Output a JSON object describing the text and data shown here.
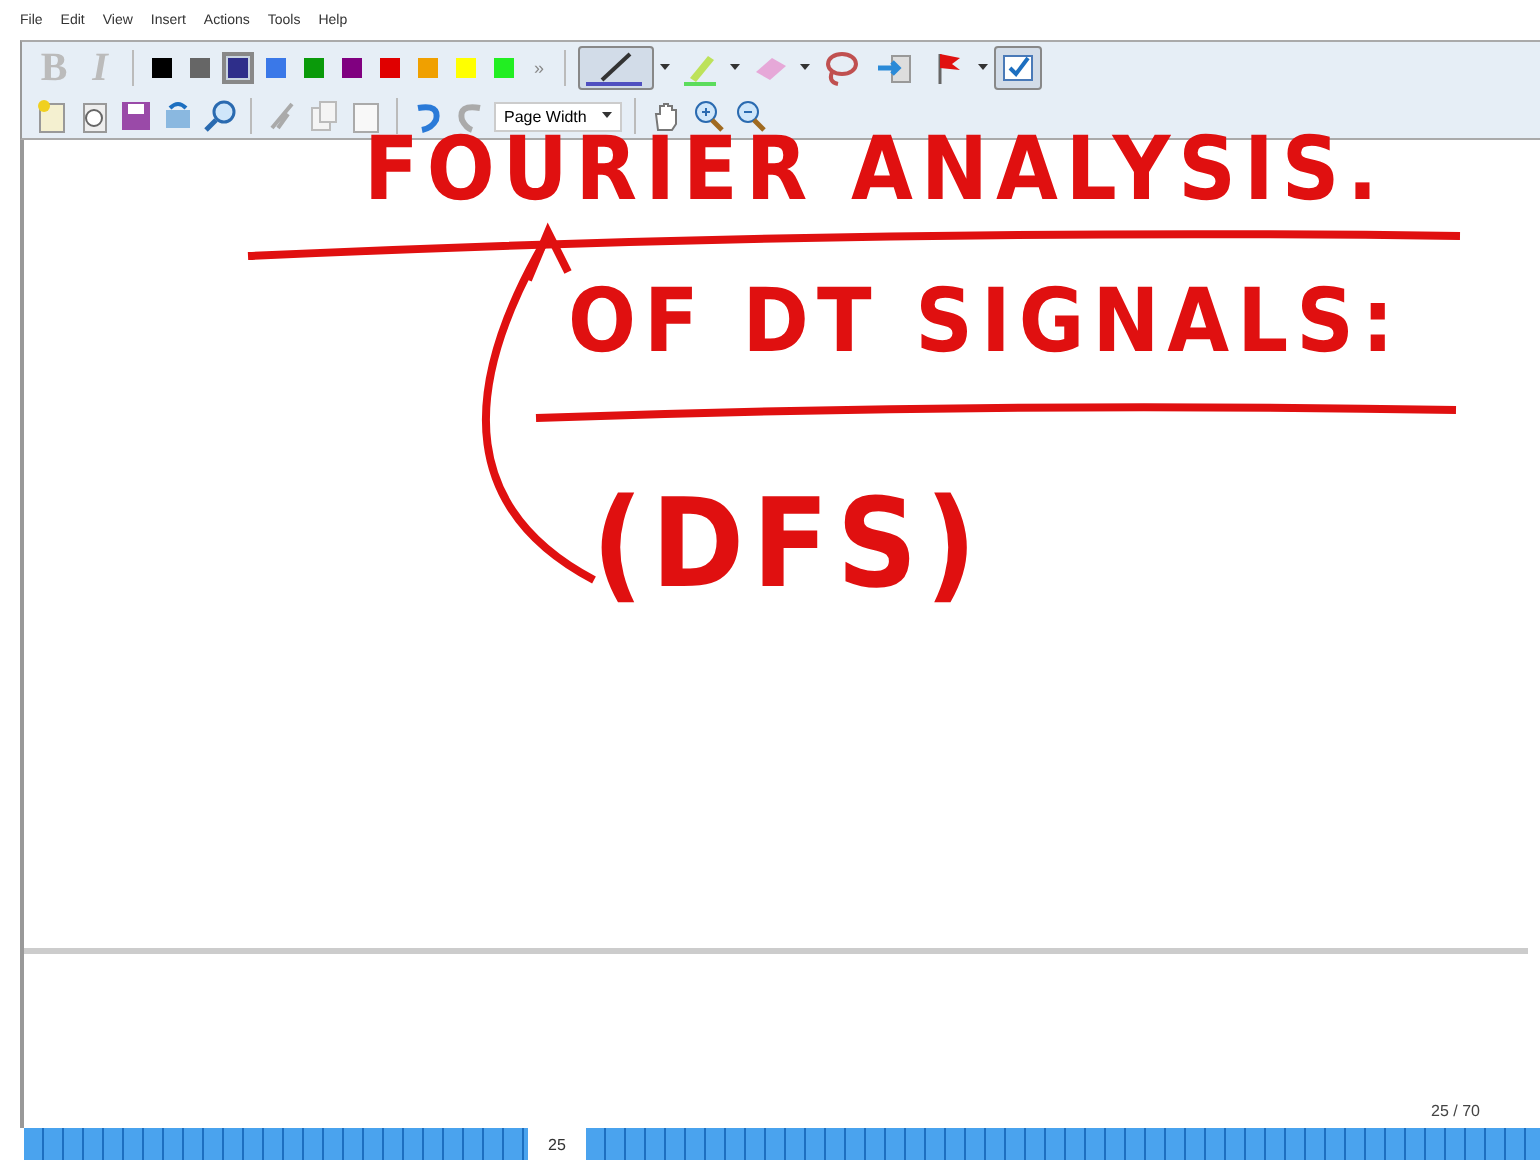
{
  "menu": [
    "File",
    "Edit",
    "View",
    "Insert",
    "Actions",
    "Tools",
    "Help"
  ],
  "format_buttons": [
    {
      "label": "B",
      "disabled": true
    },
    {
      "label": "I",
      "disabled": true
    }
  ],
  "colors": [
    {
      "color": "#000000",
      "selected": false
    },
    {
      "color": "#666666",
      "selected": false
    },
    {
      "color": "#2e2e8a",
      "selected": true
    },
    {
      "color": "#3a78e8",
      "selected": false
    },
    {
      "color": "#0a9a0a",
      "selected": false
    },
    {
      "color": "#800080",
      "selected": false
    },
    {
      "color": "#e00000",
      "selected": false
    },
    {
      "color": "#f0a000",
      "selected": false
    },
    {
      "color": "#ffff00",
      "selected": false
    },
    {
      "color": "#22ee22",
      "selected": false
    }
  ],
  "overflow": "»",
  "tools": [
    {
      "kind": "pen",
      "selected": true
    },
    {
      "kind": "highlighter",
      "selected": false
    },
    {
      "kind": "eraser",
      "selected": false
    },
    {
      "kind": "lasso",
      "selected": false
    },
    {
      "kind": "insert-space",
      "selected": false
    },
    {
      "kind": "flag",
      "selected": false
    },
    {
      "kind": "view",
      "selected": true
    }
  ],
  "zoom": {
    "value": "Page Width"
  },
  "ink": [
    {
      "text": "FOURIER ANALYSIS."
    },
    {
      "text": "OF DT SIGNALS:"
    },
    {
      "text": "(DFS)"
    }
  ],
  "page_counter": "25 / 70",
  "page_strip": {
    "current": "25"
  }
}
